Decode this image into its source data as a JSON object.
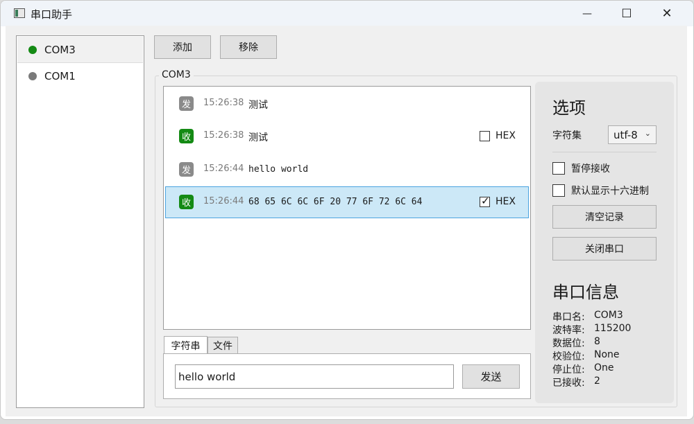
{
  "window": {
    "title": "串口助手",
    "minimize_glyph": "—",
    "maximize_glyph": "☐",
    "close_glyph": "✕"
  },
  "ports": [
    {
      "name": "COM3",
      "status_color": "#148a14"
    },
    {
      "name": "COM1",
      "status_color": "#7a7a7a"
    }
  ],
  "toolbar": {
    "add_label": "添加",
    "remove_label": "移除"
  },
  "group": {
    "title": "COM3"
  },
  "messages": [
    {
      "direction": "发",
      "tag_color": "#8a8a8a",
      "time": "15:26:38",
      "content": "测试",
      "hex_label": "",
      "hex_checked": false
    },
    {
      "direction": "收",
      "tag_color": "#148a14",
      "time": "15:26:38",
      "content": "测试",
      "hex_label": "HEX",
      "hex_checked": false
    },
    {
      "direction": "发",
      "tag_color": "#8a8a8a",
      "time": "15:26:44",
      "content": "hello world",
      "hex_label": "",
      "hex_checked": false
    },
    {
      "direction": "收",
      "tag_color": "#148a14",
      "time": "15:26:44",
      "content": "68 65 6C 6C 6F 20 77 6F 72 6C 64",
      "hex_label": "HEX",
      "hex_checked": true
    }
  ],
  "send": {
    "tabs": [
      "字符串",
      "文件"
    ],
    "input_value": "hello world",
    "send_label": "发送"
  },
  "options": {
    "title": "选项",
    "charset_label": "字符集",
    "charset_value": "utf-8",
    "pause_receive_label": "暂停接收",
    "default_hex_label": "默认显示十六进制",
    "clear_label": "清空记录",
    "close_port_label": "关闭串口"
  },
  "port_info": {
    "title": "串口信息",
    "rows": [
      {
        "key": "串口名:",
        "value": "COM3"
      },
      {
        "key": "波特率:",
        "value": "115200"
      },
      {
        "key": "数据位:",
        "value": "8"
      },
      {
        "key": "校验位:",
        "value": "None"
      },
      {
        "key": "停止位:",
        "value": "One"
      },
      {
        "key": "已接收:",
        "value": "2"
      }
    ]
  }
}
